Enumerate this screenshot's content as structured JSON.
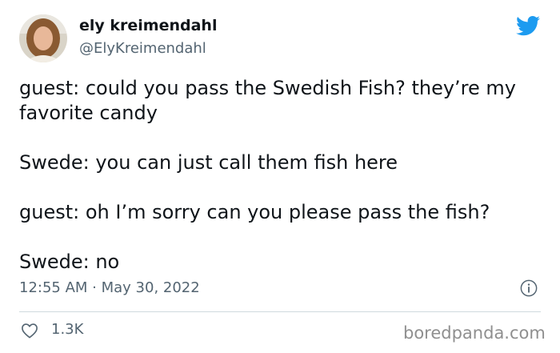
{
  "author": {
    "display_name": "ely kreimendahl",
    "handle": "@ElyKreimendahl",
    "avatar_icon": "profile-photo"
  },
  "tweet": {
    "paragraphs": [
      "guest: could you pass the Swedish Fish? they’re my favorite candy",
      "Swede: you can just call them fish here",
      "guest: oh I’m sorry can you please pass the fish?",
      "Swede: no"
    ],
    "timestamp": "12:55 AM · May 30, 2022"
  },
  "actions": {
    "like_count": "1.3K",
    "like_icon": "heart-icon",
    "info_icon": "info-icon"
  },
  "branding": {
    "platform_icon": "twitter-bird-icon",
    "watermark": "boredpanda.com"
  },
  "colors": {
    "twitter_blue": "#1d9bf0",
    "text": "#0f1419",
    "secondary_text": "#536471",
    "divider": "#cfd9de"
  }
}
